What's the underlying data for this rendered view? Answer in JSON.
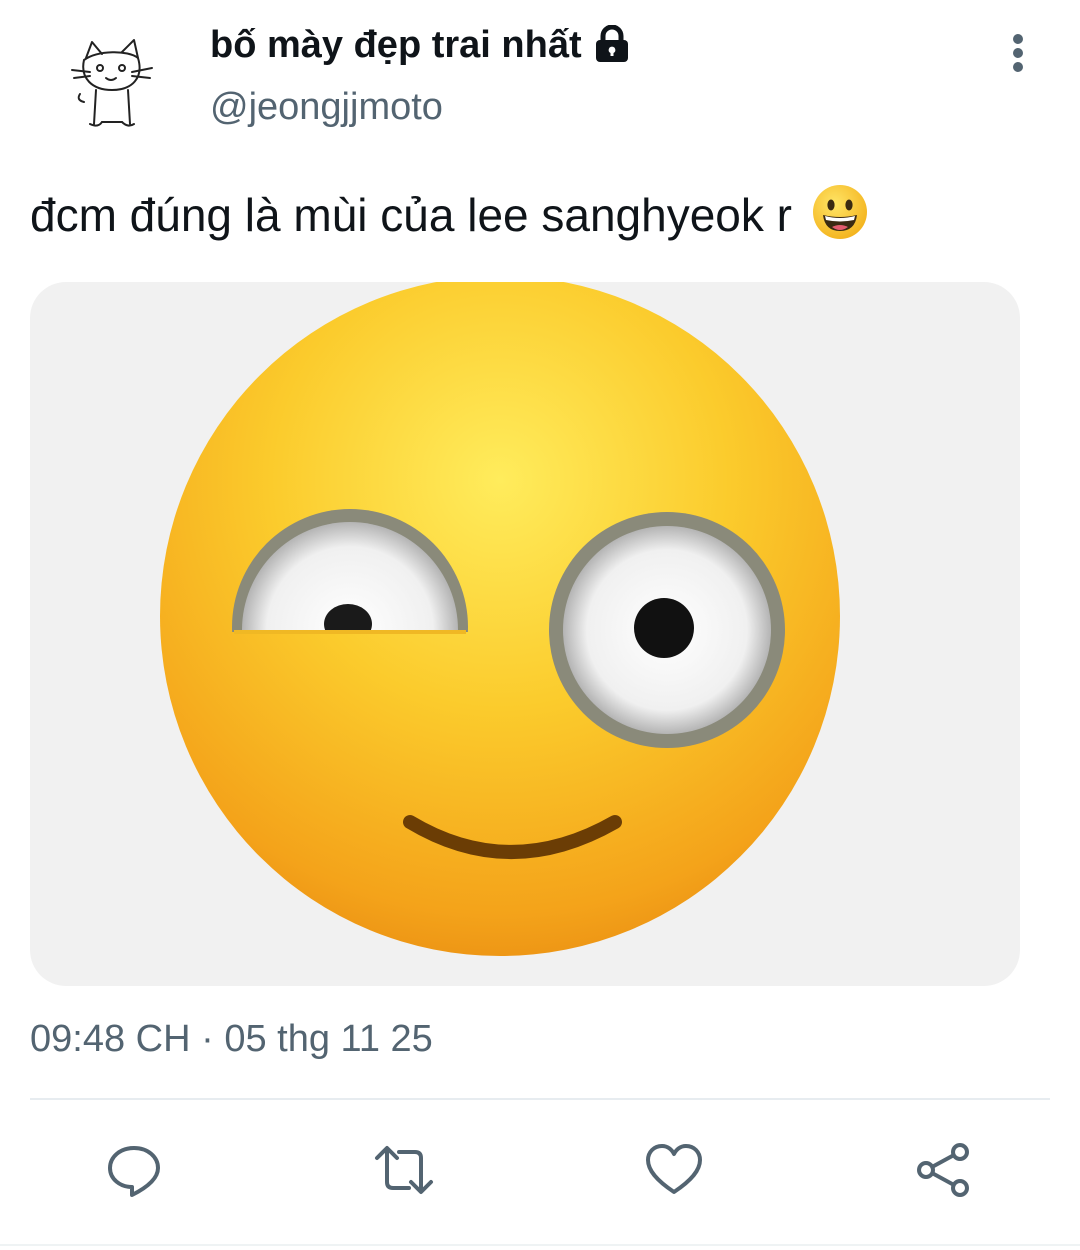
{
  "author": {
    "display_name": "bố mày đẹp trai nhất",
    "handle": "@jeongjjmoto",
    "protected": true
  },
  "tweet": {
    "text": "đcm đúng là mùi của lee sanghyeok r",
    "trailing_emoji": "grinning-face-emoji",
    "media_description_icon": "smirking-side-eye-emoji"
  },
  "meta": {
    "time": "09:48 CH",
    "separator": "·",
    "date": "05 thg 11 25"
  },
  "actions": [
    {
      "name": "reply",
      "icon": "reply-icon"
    },
    {
      "name": "retweet",
      "icon": "retweet-icon"
    },
    {
      "name": "like",
      "icon": "heart-icon"
    },
    {
      "name": "share",
      "icon": "share-icon"
    }
  ],
  "colors": {
    "text_primary": "#0f1419",
    "text_secondary": "#536471",
    "divider": "#e7ecf0",
    "media_background": "#f1f1f1",
    "emoji_yellow": "#f7c32e"
  }
}
